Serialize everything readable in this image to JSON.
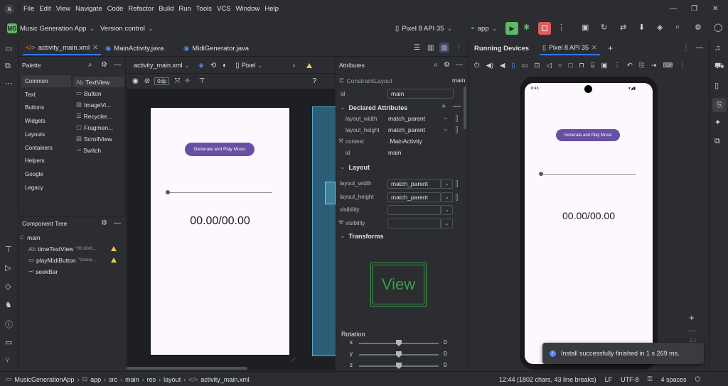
{
  "menu": [
    "File",
    "Edit",
    "View",
    "Navigate",
    "Code",
    "Refactor",
    "Build",
    "Run",
    "Tools",
    "VCS",
    "Window",
    "Help"
  ],
  "toolbar": {
    "project_badge": "MG",
    "project_name": "Music Generation App",
    "vcs": "Version control",
    "device": "Pixel 8 API 35",
    "run_config": "app"
  },
  "editor_tabs": [
    "activity_main.xml",
    "MainActivity.java",
    "MidiGenerator.java"
  ],
  "palette": {
    "title": "Palette",
    "categories": [
      "Common",
      "Text",
      "Buttons",
      "Widgets",
      "Layouts",
      "Containers",
      "Helpers",
      "Google",
      "Legacy"
    ],
    "widgets": [
      {
        "icon": "Ab",
        "label": "TextView"
      },
      {
        "icon": "▭",
        "label": "Button"
      },
      {
        "icon": "▨",
        "label": "ImageVi..."
      },
      {
        "icon": "☰",
        "label": "Recycler..."
      },
      {
        "icon": "▢",
        "label": "Fragmen..."
      },
      {
        "icon": "▤",
        "label": "ScrollView"
      },
      {
        "icon": "⊸",
        "label": "Switch"
      }
    ]
  },
  "component_tree": {
    "title": "Component Tree",
    "root": "main",
    "items": [
      {
        "icon": "Ab",
        "name": "timeTextView",
        "hint": "\"00.00/0...",
        "warn": true
      },
      {
        "icon": "▭",
        "name": "playMidiButton",
        "hint": "\"Gener...",
        "warn": true
      },
      {
        "icon": "⊸",
        "name": "seekBar",
        "hint": "",
        "warn": false
      }
    ]
  },
  "design": {
    "file": "activity_main.xml",
    "device": "Pixel",
    "margin": "0dp",
    "help": "?"
  },
  "app_ui": {
    "button_label": "Generate and Play Music",
    "timer": "00.00/00.00"
  },
  "attributes": {
    "title": "Attributes",
    "class": "ConstraintLayout",
    "id_value": "main",
    "id_label": "id",
    "declared_header": "Declared Attributes",
    "declared": [
      {
        "name": "layout_width",
        "value": "match_parent"
      },
      {
        "name": "layout_height",
        "value": "match_parent"
      },
      {
        "name": "context",
        "value": ".MainActivity"
      },
      {
        "name": "id",
        "value": "main"
      }
    ],
    "layout_header": "Layout",
    "layout": [
      {
        "name": "layout_width",
        "value": "match_parent"
      },
      {
        "name": "layout_height",
        "value": "match_parent"
      },
      {
        "name": "visibility",
        "value": ""
      },
      {
        "name": "visibility",
        "value": ""
      }
    ],
    "transforms_header": "Transforms",
    "view_label": "View",
    "rotation_label": "Rotation",
    "rotation": [
      {
        "axis": "x",
        "value": "0"
      },
      {
        "axis": "y",
        "value": "0"
      },
      {
        "axis": "z",
        "value": "0"
      }
    ]
  },
  "running_devices": {
    "title": "Running Devices",
    "tab": "Pixel 8 API 35",
    "status_time": "8:45",
    "zoom_label": "1:1"
  },
  "toast": "Install successfully finished in 1 s 269 ms.",
  "breadcrumbs": [
    "MusicGenerationApp",
    "app",
    "src",
    "main",
    "res",
    "layout",
    "activity_main.xml"
  ],
  "status": {
    "position": "12:44 (1802 chars, 43 line breaks)",
    "line_sep": "LF",
    "encoding": "UTF-8",
    "indent": "4 spaces"
  },
  "colors": {
    "accent": "#3574f0",
    "primary_button": "#6750a4",
    "run_green": "#5fb865",
    "stop_red": "#db5c5c",
    "warning": "#f2c55c"
  }
}
